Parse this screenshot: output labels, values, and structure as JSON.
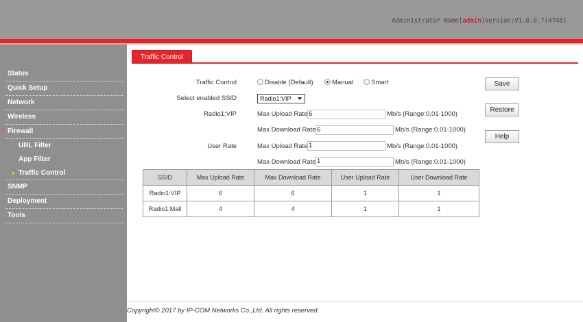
{
  "header": {
    "admin_prefix": "Administrator Name[",
    "admin_user": "admin",
    "version_text": "]Version:V1.0.0.7(4748)"
  },
  "sidebar": {
    "items": [
      {
        "label": "Status"
      },
      {
        "label": "Quick Setup"
      },
      {
        "label": "Network"
      },
      {
        "label": "Wireless"
      },
      {
        "label": "Firewall"
      },
      {
        "label": "URL Filter"
      },
      {
        "label": "App Filter"
      },
      {
        "label": "Traffic Control"
      },
      {
        "label": "SNMP"
      },
      {
        "label": "Deployment"
      },
      {
        "label": "Tools"
      }
    ]
  },
  "tab": {
    "label": "Traffic Control"
  },
  "form": {
    "traffic_control_label": "Traffic Control",
    "mode_options": [
      {
        "label": "Disable (Default)",
        "selected": false
      },
      {
        "label": "Manual",
        "selected": true
      },
      {
        "label": "Smart",
        "selected": false
      }
    ],
    "ssid_label": "Select enabled SSID",
    "ssid_value": "Radio1:VIP",
    "radio_group_label": "Radio1:VIP",
    "max_upload_label": "Max Upload Rate:",
    "max_upload_value": "6",
    "max_upload_unit": "Mb/s (Range:0.01-1000)",
    "max_download_label": "Max Download Rate:",
    "max_download_value": "6",
    "max_download_unit": "Mb/s (Range:0.01-1000)",
    "user_rate_label": "User Rate",
    "user_upload_label": "Max Upload Rate:",
    "user_upload_value": "1",
    "user_upload_unit": "Mb/s (Range:0.01-1000)",
    "user_download_label": "Max Download Rate:",
    "user_download_value": "1",
    "user_download_unit": "Mb/s (Range:0.01-1000)"
  },
  "buttons": {
    "save": "Save",
    "restore": "Restore",
    "help": "Help"
  },
  "table": {
    "headers": [
      "SSID",
      "Max Upload Rate",
      "Max Download Rate",
      "User Upload Rate",
      "User Download Rate"
    ],
    "rows": [
      [
        "Radio1:VIP",
        "6",
        "6",
        "1",
        "1"
      ],
      [
        "Radio1:Mall",
        "4",
        "4",
        "1",
        "1"
      ]
    ]
  },
  "footer": {
    "copyright": "Copyright© 2017 by IP-COM Networks Co.,Ltd. All rights reserved."
  }
}
